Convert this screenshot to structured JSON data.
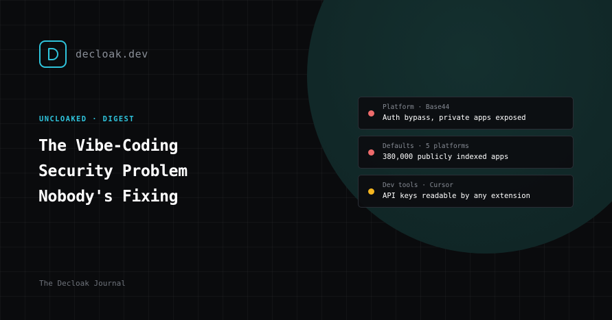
{
  "brand": {
    "name": "decloak.dev",
    "accent_color": "#2fc4dc",
    "logo_icon": "d-letter-icon"
  },
  "kicker": "UNCLOAKED · DIGEST",
  "headline": {
    "lines": [
      "The Vibe-Coding",
      "Security Problem",
      "Nobody's Fixing"
    ]
  },
  "footer": "The Decloak Journal",
  "findings": [
    {
      "meta": "Platform · Base44",
      "title": "Auth bypass, private apps exposed",
      "status_color": "#ee6b6b"
    },
    {
      "meta": "Defaults · 5 platforms",
      "title": "380,000 publicly indexed apps",
      "status_color": "#ee6b6b"
    },
    {
      "meta": "Dev tools · Cursor",
      "title": "API keys readable by any extension",
      "status_color": "#f5b620"
    }
  ]
}
